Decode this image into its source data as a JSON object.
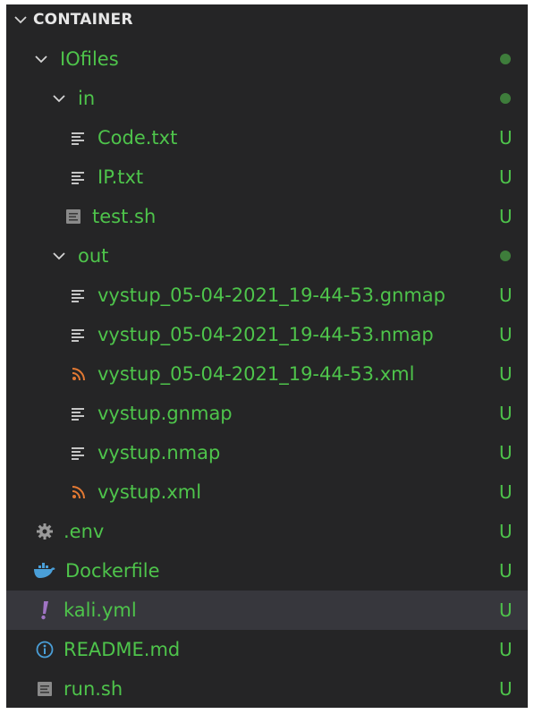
{
  "explorer": {
    "section_title": "CONTAINER",
    "items": [
      {
        "label": "IOfiles",
        "status": "",
        "icon": "chevron-down-icon"
      },
      {
        "label": "in",
        "status": "",
        "icon": "chevron-down-icon"
      },
      {
        "label": "Code.txt",
        "status": "U",
        "icon": "text-file-icon"
      },
      {
        "label": "IP.txt",
        "status": "U",
        "icon": "text-file-icon"
      },
      {
        "label": "test.sh",
        "status": "U",
        "icon": "shell-script-icon"
      },
      {
        "label": "out",
        "status": "",
        "icon": "chevron-down-icon"
      },
      {
        "label": "vystup_05-04-2021_19-44-53.gnmap",
        "status": "U",
        "icon": "text-file-icon"
      },
      {
        "label": "vystup_05-04-2021_19-44-53.nmap",
        "status": "U",
        "icon": "text-file-icon"
      },
      {
        "label": "vystup_05-04-2021_19-44-53.xml",
        "status": "U",
        "icon": "rss-xml-icon"
      },
      {
        "label": "vystup.gnmap",
        "status": "U",
        "icon": "text-file-icon"
      },
      {
        "label": "vystup.nmap",
        "status": "U",
        "icon": "text-file-icon"
      },
      {
        "label": "vystup.xml",
        "status": "U",
        "icon": "rss-xml-icon"
      },
      {
        "label": ".env",
        "status": "U",
        "icon": "gear-icon"
      },
      {
        "label": "Dockerfile",
        "status": "U",
        "icon": "docker-whale-icon"
      },
      {
        "label": "kali.yml",
        "status": "U",
        "icon": "exclamation-icon"
      },
      {
        "label": "README.md",
        "status": "U",
        "icon": "info-icon"
      },
      {
        "label": "run.sh",
        "status": "U",
        "icon": "shell-script-icon"
      }
    ]
  },
  "colors": {
    "background": "#252526",
    "untracked_green": "#4ec44b",
    "folder_dot": "#3e7d3b",
    "selected_row": "#37373d",
    "header_text": "#e6e6e6",
    "xml_orange": "#e37933",
    "yaml_purple": "#a074c4",
    "docker_blue": "#4a9fd8"
  }
}
